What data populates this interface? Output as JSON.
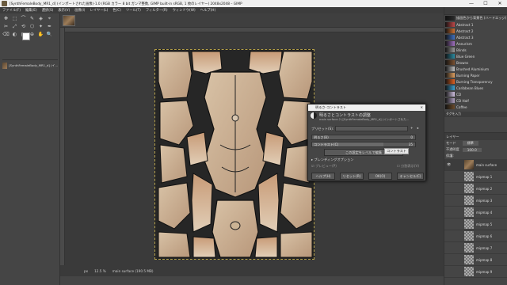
{
  "window": {
    "title": "[SynthFemaleBody_MR1_d] (インポートされた画像)-1.0 (RGB カラー 8 bit ガンマ整数, GIMP built-in sRGB, 1 枚のレイヤー) 2048x2048 – GIMP",
    "minimize": "—",
    "maximize": "☐",
    "close": "✕"
  },
  "menu": [
    "ファイル(F)",
    "編集(E)",
    "選択(S)",
    "表示(V)",
    "画像(I)",
    "レイヤー(L)",
    "色(C)",
    "ツール(T)",
    "フィルター(R)",
    "ウィンドウ(W)",
    "ヘルプ(H)"
  ],
  "toolbox": {
    "tools": [
      "✥",
      "⬚",
      "⌒",
      "✎",
      "◈",
      "⌖",
      "✂",
      "⤢",
      "⟲",
      "⬡",
      "✦",
      "✒",
      "⌫",
      "◐",
      "▦",
      "⊕",
      "✋",
      "🔍"
    ],
    "options_label": "[SynthFemaleBody_MR1_d] (イ...",
    "fg_color": "#ffffff",
    "bg_color": "#111111"
  },
  "statusbar": {
    "unit": "px",
    "zoom": "12.5 %",
    "layer_info": "main surface (190.5 MB)"
  },
  "dock": {
    "gradients": [
      {
        "name": "描画色から背景色 (ハードエッジ)",
        "color": "#2a2a2a"
      },
      {
        "name": "Abstract 1",
        "color": "#c04848"
      },
      {
        "name": "Abstract 2",
        "color": "#d07030"
      },
      {
        "name": "Abstract 3",
        "color": "#4070c0"
      },
      {
        "name": "Aneurism",
        "color": "#a070c0"
      },
      {
        "name": "Blinds",
        "color": "#9a9a9a"
      },
      {
        "name": "Blue Green",
        "color": "#2a8aa0"
      },
      {
        "name": "Browns",
        "color": "#7a5030"
      },
      {
        "name": "Brushed Aluminium",
        "color": "#c0c0c0"
      },
      {
        "name": "Burning Paper",
        "color": "#e0a060"
      },
      {
        "name": "Burning Transparency",
        "color": "#e06020"
      },
      {
        "name": "Caribbean Blues",
        "color": "#3aa0d0"
      },
      {
        "name": "CD",
        "color": "#d0c0e0"
      },
      {
        "name": "CD Half",
        "color": "#b0a0c0"
      },
      {
        "name": "Coffee",
        "color": "#6a4a2a"
      }
    ],
    "tags_label": "タグを入力",
    "layers_tabs": "レイヤー",
    "mode": "モード",
    "mode_value": "標準",
    "opacity_label": "不透明度",
    "opacity_value": "100.0",
    "lock_label": "保護:",
    "layers": [
      "main surface",
      "mipmap 1",
      "mipmap 2",
      "mipmap 3",
      "mipmap 4",
      "mipmap 5",
      "mipmap 6",
      "mipmap 7",
      "mipmap 8",
      "mipmap 9"
    ]
  },
  "dialog": {
    "window_title": "明るさ-コントラスト",
    "heading": "明るさとコントラストの調整",
    "subheading": "main surface-2 ([SynthFemaleBody_MR1_d] (インポートされた...",
    "preset_label": "プリセット(S):",
    "brightness_label": "明るさ(B)",
    "brightness_value": "0",
    "contrast_label": "コントラスト(C)",
    "contrast_value": "35",
    "levels_button": "この設定をレベルで編集",
    "tooltip": "コントラスト",
    "blending_label": "ブレンディングオプション",
    "preview_label": "プレビュー(P)",
    "split_view_label": "分割表示(V)",
    "help_button": "ヘルプ(H)",
    "reset_button": "リセット(R)",
    "ok_button": "OK(O)",
    "cancel_button": "キャンセル(C)"
  }
}
